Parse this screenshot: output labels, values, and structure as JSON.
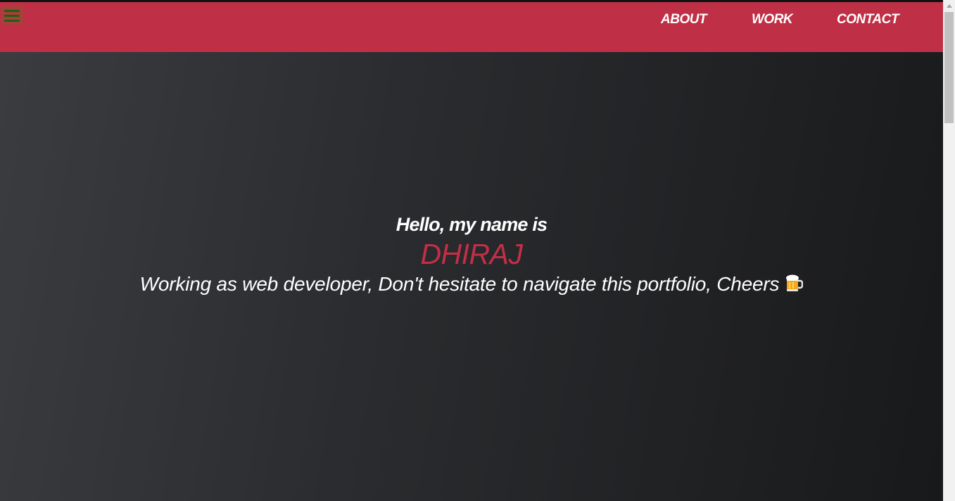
{
  "header": {
    "menu_icon": "hamburger-icon",
    "nav": [
      {
        "label": "ABOUT"
      },
      {
        "label": "WORK"
      },
      {
        "label": "CONTACT"
      }
    ],
    "background_color": "#bf3046"
  },
  "hero": {
    "greeting": "Hello, my name is",
    "name": "DHIRAJ",
    "tagline": "Working as web developer, Don't hesitate to navigate this portfolio, Cheers",
    "tagline_icon": "beer-mug-icon",
    "accent_color": "#c22f47"
  }
}
